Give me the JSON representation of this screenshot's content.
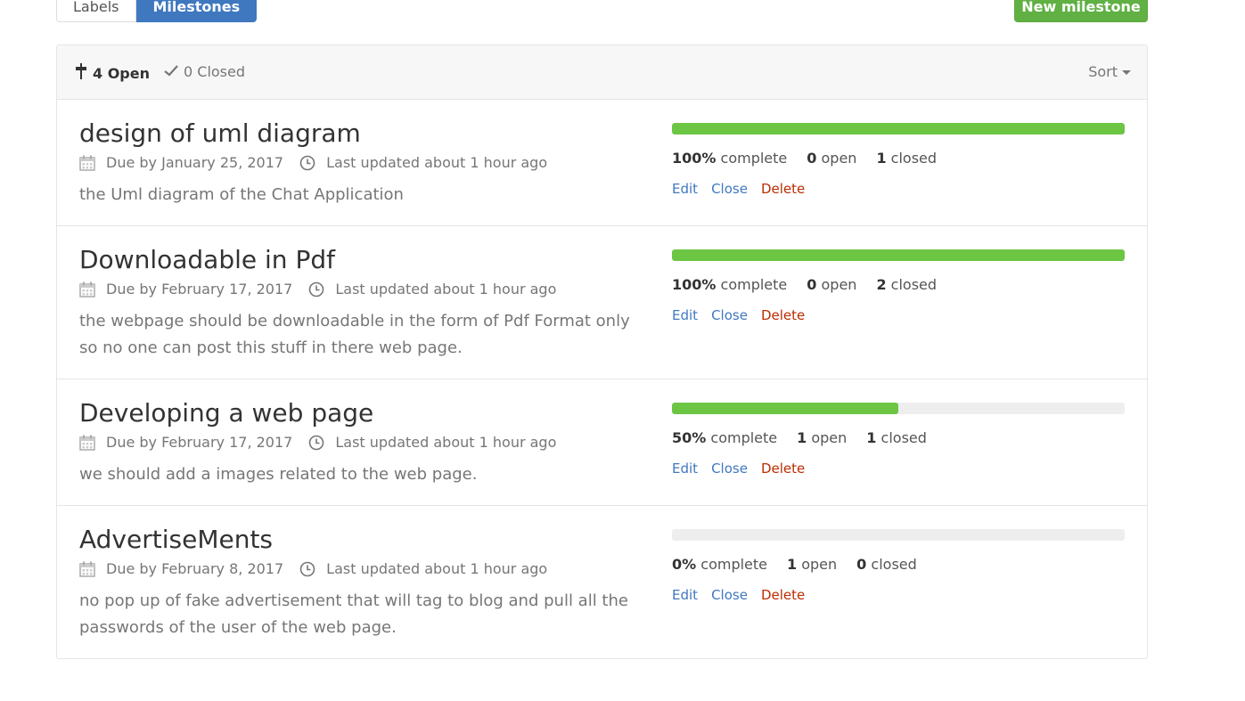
{
  "nav": {
    "labels_tab": "Labels",
    "milestones_tab": "Milestones",
    "new_milestone_button": "New milestone"
  },
  "header": {
    "open_label": "4 Open",
    "closed_label": "0 Closed",
    "sort_label": "Sort"
  },
  "milestones": [
    {
      "title": "design of uml diagram",
      "due": "Due by January 25, 2017",
      "updated": "Last updated about 1 hour ago",
      "description": "the Uml diagram of the Chat Application",
      "progress": 100,
      "percent_label": "100%",
      "complete_label": "complete",
      "open_count": "0",
      "open_label": "open",
      "closed_count": "1",
      "closed_label": "closed",
      "actions": {
        "edit": "Edit",
        "close": "Close",
        "delete": "Delete"
      }
    },
    {
      "title": "Downloadable in Pdf",
      "due": "Due by February 17, 2017",
      "updated": "Last updated about 1 hour ago",
      "description": "the webpage should be downloadable in the form of Pdf Format only so no one can post this stuff in there web page.",
      "progress": 100,
      "percent_label": "100%",
      "complete_label": "complete",
      "open_count": "0",
      "open_label": "open",
      "closed_count": "2",
      "closed_label": "closed",
      "actions": {
        "edit": "Edit",
        "close": "Close",
        "delete": "Delete"
      }
    },
    {
      "title": "Developing a web page",
      "due": "Due by February 17, 2017",
      "updated": "Last updated about 1 hour ago",
      "description": "we should add a images related to the web page.",
      "progress": 50,
      "percent_label": "50%",
      "complete_label": "complete",
      "open_count": "1",
      "open_label": "open",
      "closed_count": "1",
      "closed_label": "closed",
      "actions": {
        "edit": "Edit",
        "close": "Close",
        "delete": "Delete"
      }
    },
    {
      "title": "AdvertiseMents",
      "due": "Due by February 8, 2017",
      "updated": "Last updated about 1 hour ago",
      "description": "no pop up of fake advertisement that will tag to blog and pull all the passwords of the user of the web page.",
      "progress": 0,
      "percent_label": "0%",
      "complete_label": "complete",
      "open_count": "1",
      "open_label": "open",
      "closed_count": "0",
      "closed_label": "closed",
      "actions": {
        "edit": "Edit",
        "close": "Close",
        "delete": "Delete"
      }
    }
  ],
  "colors": {
    "accent_blue": "#4078c0",
    "progress_green": "#6cc644",
    "delete_red": "#bd2c00",
    "button_green": "#60b044"
  }
}
